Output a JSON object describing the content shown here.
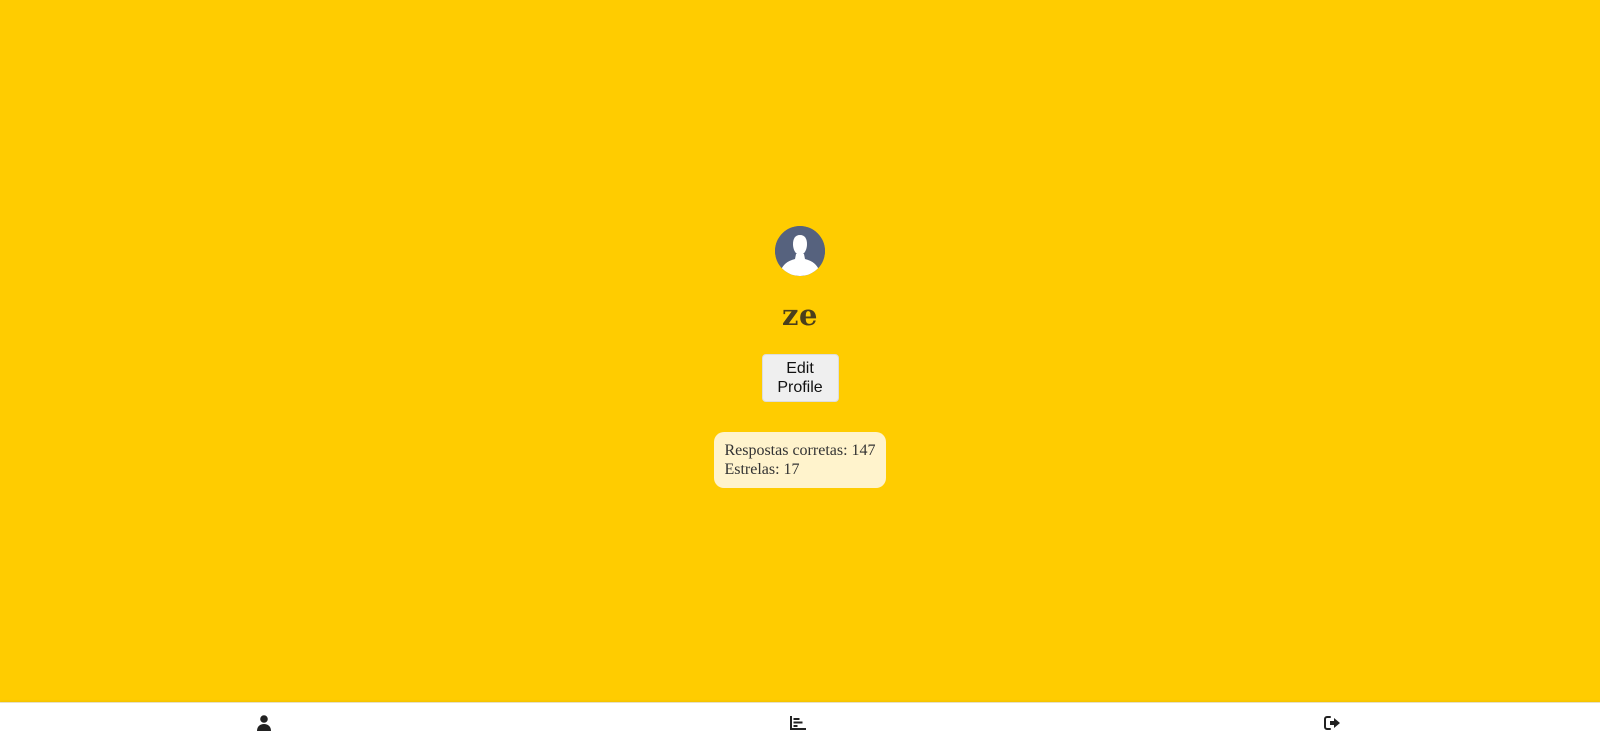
{
  "profile": {
    "username": "ze",
    "avatar_icon": "user-avatar-icon",
    "edit_button_line1": "Edit",
    "edit_button_line2": "Profile"
  },
  "stats": {
    "correct_label": "Respostas corretas: 147",
    "stars_label": "Estrelas: 17"
  },
  "nav": {
    "items": [
      {
        "icon": "user-icon"
      },
      {
        "icon": "chart-bar-icon"
      },
      {
        "icon": "sign-out-icon"
      }
    ]
  },
  "colors": {
    "background": "#FFCC00",
    "avatar_bg": "#56627E",
    "stats_bg": "#FFF3CC",
    "nav_bg": "#FFFFFF"
  }
}
